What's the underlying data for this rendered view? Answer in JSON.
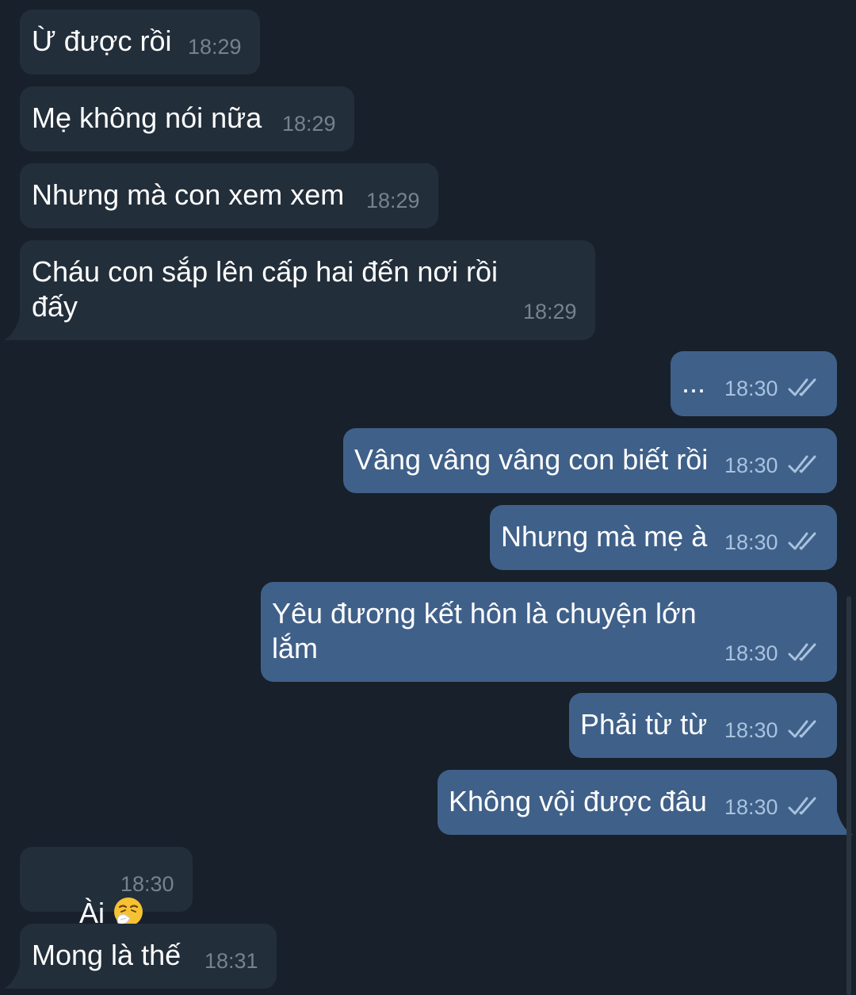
{
  "messages": [
    {
      "text": "Ừ được rồi",
      "time": "18:29",
      "direction": "incoming"
    },
    {
      "text": "Mẹ không nói nữa",
      "time": "18:29",
      "direction": "incoming"
    },
    {
      "text": "Nhưng mà con xem xem",
      "time": "18:29",
      "direction": "incoming"
    },
    {
      "text": "Cháu con sắp lên cấp hai đến nơi rồi\nđấy",
      "time": "18:29",
      "direction": "incoming"
    },
    {
      "text": "...",
      "time": "18:30",
      "direction": "outgoing",
      "status": "read"
    },
    {
      "text": "Vâng vâng vâng con biết rồi",
      "time": "18:30",
      "direction": "outgoing",
      "status": "read"
    },
    {
      "text": "Nhưng mà mẹ à",
      "time": "18:30",
      "direction": "outgoing",
      "status": "read"
    },
    {
      "text": "Yêu đương kết hôn là chuyện lớn\nlắm",
      "time": "18:30",
      "direction": "outgoing",
      "status": "read"
    },
    {
      "text": "Phải từ từ",
      "time": "18:30",
      "direction": "outgoing",
      "status": "read"
    },
    {
      "text": "Không vội được đâu",
      "time": "18:30",
      "direction": "outgoing",
      "status": "read"
    },
    {
      "text": "Ài",
      "emoji": "sneezing-face-icon",
      "time": "18:30",
      "direction": "incoming"
    },
    {
      "text": "Mong là thế",
      "time": "18:31",
      "direction": "incoming"
    }
  ],
  "colors": {
    "background": "#18202b",
    "incoming_bubble": "#222e3a",
    "outgoing_bubble": "#3f6089",
    "incoming_time": "#76838f",
    "outgoing_time": "#a9c2de",
    "read_ticks": "#a9c2de"
  }
}
